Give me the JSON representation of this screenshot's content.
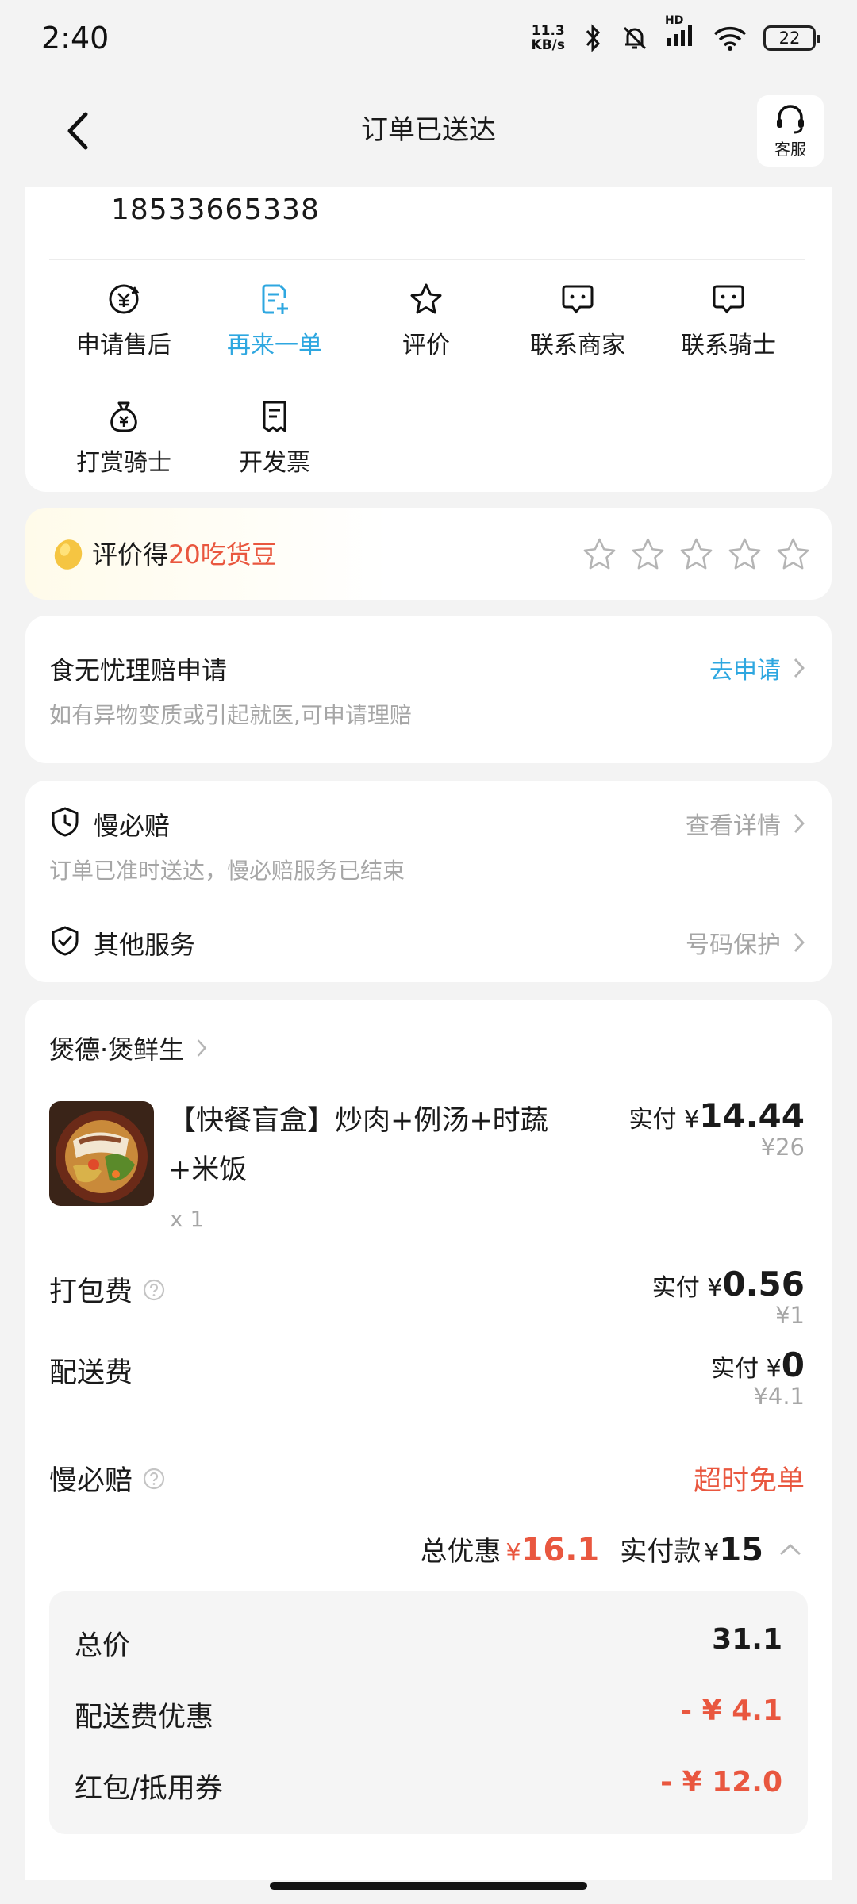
{
  "status_bar": {
    "time": "2:40",
    "net_speed_value": "11.3",
    "net_speed_unit": "KB/s",
    "hd_label": "HD",
    "battery": "22"
  },
  "nav": {
    "title": "订单已送达",
    "cs_label": "客服"
  },
  "order_info": {
    "phone": "18533665338"
  },
  "actions": [
    {
      "label": "申请售后",
      "icon": "after-sale-icon"
    },
    {
      "label": "再来一单",
      "icon": "reorder-icon",
      "highlight": true
    },
    {
      "label": "评价",
      "icon": "star-icon"
    },
    {
      "label": "联系商家",
      "icon": "chat-icon"
    },
    {
      "label": "联系骑士",
      "icon": "chat-icon"
    },
    {
      "label": "打赏骑士",
      "icon": "money-bag-icon"
    },
    {
      "label": "开发票",
      "icon": "receipt-icon"
    }
  ],
  "rating": {
    "prefix": "评价得",
    "highlight": "20吃货豆",
    "star_count": 5,
    "selected_stars": 0
  },
  "claim": {
    "title": "食无忧理赔申请",
    "subtitle": "如有异物变质或引起就医,可申请理赔",
    "link": "去申请"
  },
  "services": {
    "slow_title": "慢必赔",
    "slow_link": "查看详情",
    "slow_subtitle": "订单已准时送达，慢必赔服务已结束",
    "other_title": "其他服务",
    "other_link": "号码保护"
  },
  "order": {
    "shop_name": "煲德·煲鲜生",
    "item": {
      "name": "【快餐盲盒】炒肉+例汤+时蔬+米饭",
      "qty": "x 1",
      "paid_label": "实付",
      "paid_price": "14.44",
      "orig_price": "¥26"
    },
    "fees": [
      {
        "label": "打包费",
        "paid_label": "实付",
        "paid": "0.56",
        "orig": "¥1"
      },
      {
        "label": "配送费",
        "paid_label": "实付",
        "paid": "0",
        "orig": "¥4.1"
      }
    ],
    "slow_pay_label": "慢必赔",
    "slow_pay_value": "超时免单",
    "summary": {
      "discount_label": "总优惠",
      "discount_value": "16.1",
      "paid_label": "实付款",
      "paid_value": "15"
    },
    "details": [
      {
        "label": "总价",
        "value": "31.1"
      },
      {
        "label": "配送费优惠",
        "value": "- ¥ 4.1"
      },
      {
        "label": "红包/抵用券",
        "value": "- ¥ 12.0"
      }
    ]
  },
  "colors": {
    "accent_blue": "#2ea7e0",
    "accent_red": "#e9573f",
    "muted": "#a6a6a6"
  }
}
